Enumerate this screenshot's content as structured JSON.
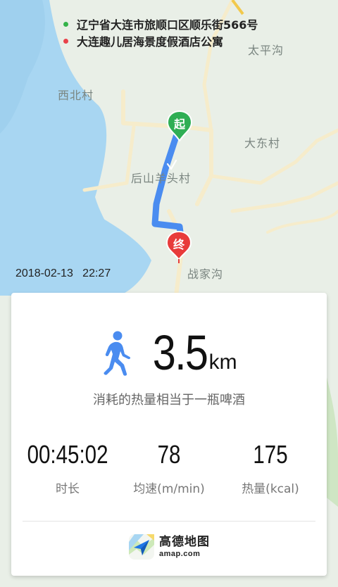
{
  "map": {
    "place_labels": {
      "taiping_gou": "太平沟",
      "xibei_cun": "西北村",
      "dadong_cun": "大东村",
      "houshan_yangtou_cun": "后山羊头村",
      "zhanjia_gou": "战家沟"
    },
    "start_marker": "起",
    "end_marker": "终",
    "colors": {
      "land": "#e9efe7",
      "water": "#a8d6f2",
      "road": "#f6eccb",
      "route": "#4a8cf0",
      "start": "#2fae54",
      "end": "#e83b3b"
    }
  },
  "addresses": {
    "start": "辽宁省大连市旅顺口区顺乐街566号",
    "end": "大连趣儿居海景度假酒店公寓",
    "start_color": "#35b34a",
    "end_color": "#e9424a"
  },
  "timestamp": "2018-02-13   22:27",
  "summary": {
    "activity_icon": "walking-person-icon",
    "distance_value": "3.5",
    "distance_unit": "km",
    "equivalent": "消耗的热量相当于一瓶啤酒",
    "stats": [
      {
        "value": "00:45:02",
        "label": "时长"
      },
      {
        "value": "78",
        "label": "均速(m/min)"
      },
      {
        "value": "175",
        "label": "热量(kcal)"
      }
    ]
  },
  "brand": {
    "logo_icon": "amap-logo-icon",
    "name": "高德地图",
    "url": "amap.com"
  }
}
